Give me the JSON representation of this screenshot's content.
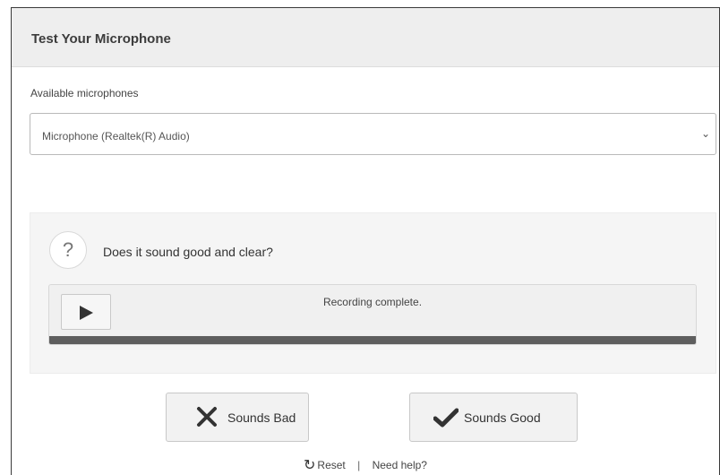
{
  "dialog": {
    "title": "Test Your Microphone"
  },
  "microphone": {
    "label": "Available microphones",
    "selected": "Microphone (Realtek(R) Audio)"
  },
  "test": {
    "question": "Does it sound good and clear?",
    "question_icon": "question-icon",
    "status": "Recording complete.",
    "progress_fraction": 1.0
  },
  "actions": {
    "bad_label": "Sounds Bad",
    "good_label": "Sounds Good"
  },
  "footer": {
    "reset_label": "Reset",
    "separator": "|",
    "help_label": "Need help?"
  },
  "colors": {
    "header_bg": "#eeeeee",
    "panel_bg": "#f5f5f5",
    "progress_fill": "#5e5e5e"
  }
}
